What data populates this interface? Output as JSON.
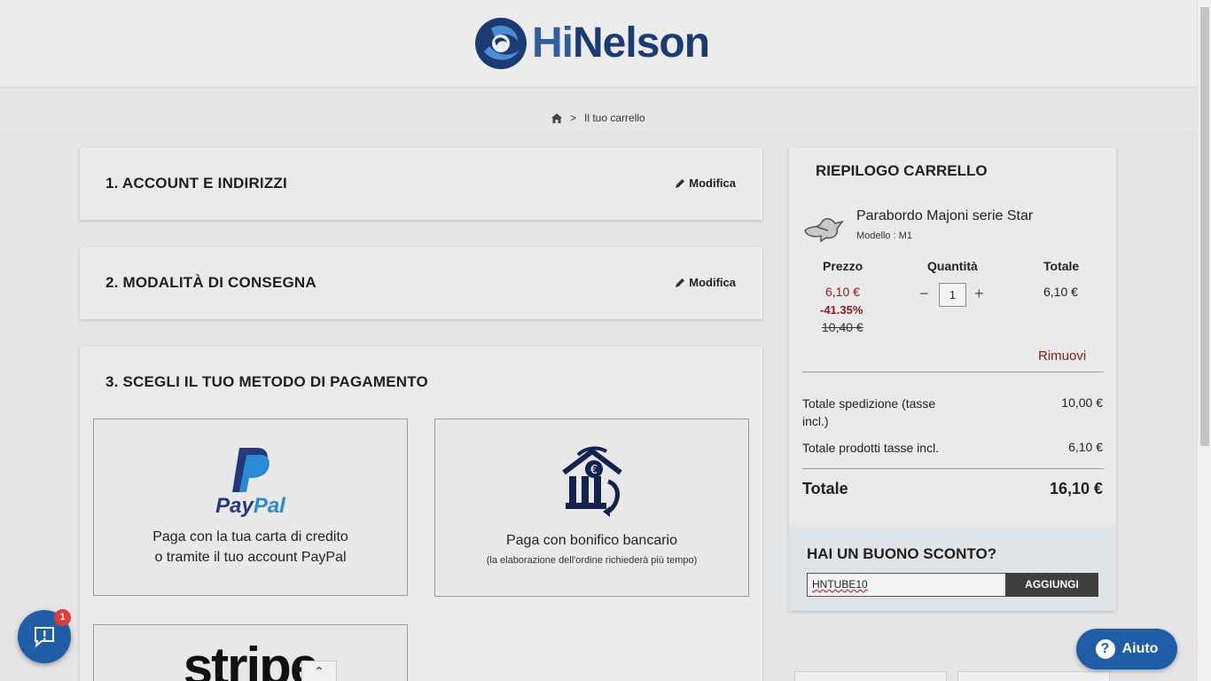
{
  "header": {
    "logo_hi": "Hi",
    "logo_rest": "Nelson"
  },
  "breadcrumb": {
    "separator": ">",
    "current": "Il tuo carrello",
    "home_icon": "home-icon"
  },
  "steps": [
    {
      "title": "1.  ACCOUNT E INDIRIZZI",
      "edit_label": "Modifica"
    },
    {
      "title": "2.  MODALITÀ DI CONSEGNA",
      "edit_label": "Modifica"
    },
    {
      "title": "3.  SCEGLI IL TUO METODO DI PAGAMENTO"
    }
  ],
  "payment": {
    "paypal": {
      "logo_pay": "Pay",
      "logo_pal": "Pal",
      "line1": "Paga con la tua carta di credito",
      "line2": "o tramite il tuo account PayPal"
    },
    "bank": {
      "line1": "Paga con bonifico bancario",
      "note": "(la elaborazione dell'ordine richiederà più tempo)"
    },
    "stripe": {
      "logo": "stripe"
    }
  },
  "summary": {
    "title": "RIEPILOGO CARRELLO",
    "product": {
      "name": "Parabordo Majoni serie Star",
      "model": "Modello : M1"
    },
    "headers": {
      "price": "Prezzo",
      "qty": "Quantità",
      "total": "Totale"
    },
    "price_new": "6,10 €",
    "discount": "-41.35%",
    "price_old": "10,40 €",
    "qty": "1",
    "line_total": "6,10 €",
    "remove_label": "Rimuovi",
    "shipping_label": "Totale spedizione (tasse incl.)",
    "shipping_value": "10,00 €",
    "products_label": "Totale prodotti tasse incl.",
    "products_value": "6,10 €",
    "grand_label": "Totale",
    "grand_value": "16,10 €"
  },
  "voucher": {
    "title": "HAI UN BUONO SCONTO?",
    "input_value": "HNTUBE10",
    "button_label": "AGGIUNGI"
  },
  "chat": {
    "badge": "1"
  },
  "help": {
    "label": "Aiuto",
    "icon_text": "?"
  },
  "colors": {
    "brand": "#1b3c73",
    "accent_blue": "#1f5ea6",
    "price_red": "#8b1a1a"
  }
}
